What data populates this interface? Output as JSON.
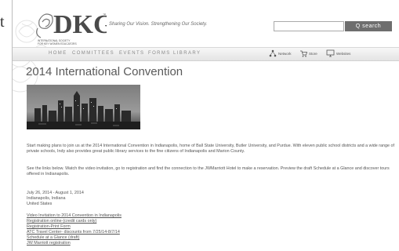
{
  "edge": {
    "char": "t"
  },
  "header": {
    "logo_text": "DKG",
    "logo_tm": "™",
    "logo_sub_1": "INTERNATIONAL SOCIETY",
    "logo_sub_2": "FOR KEY WOMEN EDUCATORS",
    "tagline": "Sharing Our Vision. Strengthening Our Society.",
    "search_button": "Q  search"
  },
  "nav": {
    "items": [
      "HOME",
      "COMMITTEES",
      "EVENTS",
      "FORMS",
      "LIBRARY"
    ],
    "utility": [
      {
        "label": "Network",
        "icon": "network-icon"
      },
      {
        "label": "Store",
        "icon": "cart-icon"
      },
      {
        "label": "Websites",
        "icon": "monitor-icon"
      }
    ]
  },
  "main": {
    "title": "2014 International Convention",
    "paragraph1": "Start making plans to join us at the 2014 International Convention in Indianapolis, home of Ball State University, Butler University, and Purdue. With eleven public school districts and a wide range of private schools, Indy also provides great public library services to the fine citizens of Indianapolis and Marion County.",
    "paragraph2": "See the links below. Watch the video invitation, go to registration and find the connection to the JWMarriott Hotel to make a reservation. Preview the draft Schedule at a Glance and discover tours offered in Indianapolis.",
    "address": [
      "July 26, 2014 - August 1, 2014",
      "Indianapolis, Indiana",
      "United States"
    ],
    "links": [
      "Video Invitation to 2014 Convention in Indianapolis",
      "Registration online-(credit cards only)",
      "Registration-Print Form",
      "ATC Travel Center- discounts from 7/25/14-8/7/14",
      "Schedule at a Glance (draft)",
      "JW Marriott registration"
    ]
  }
}
